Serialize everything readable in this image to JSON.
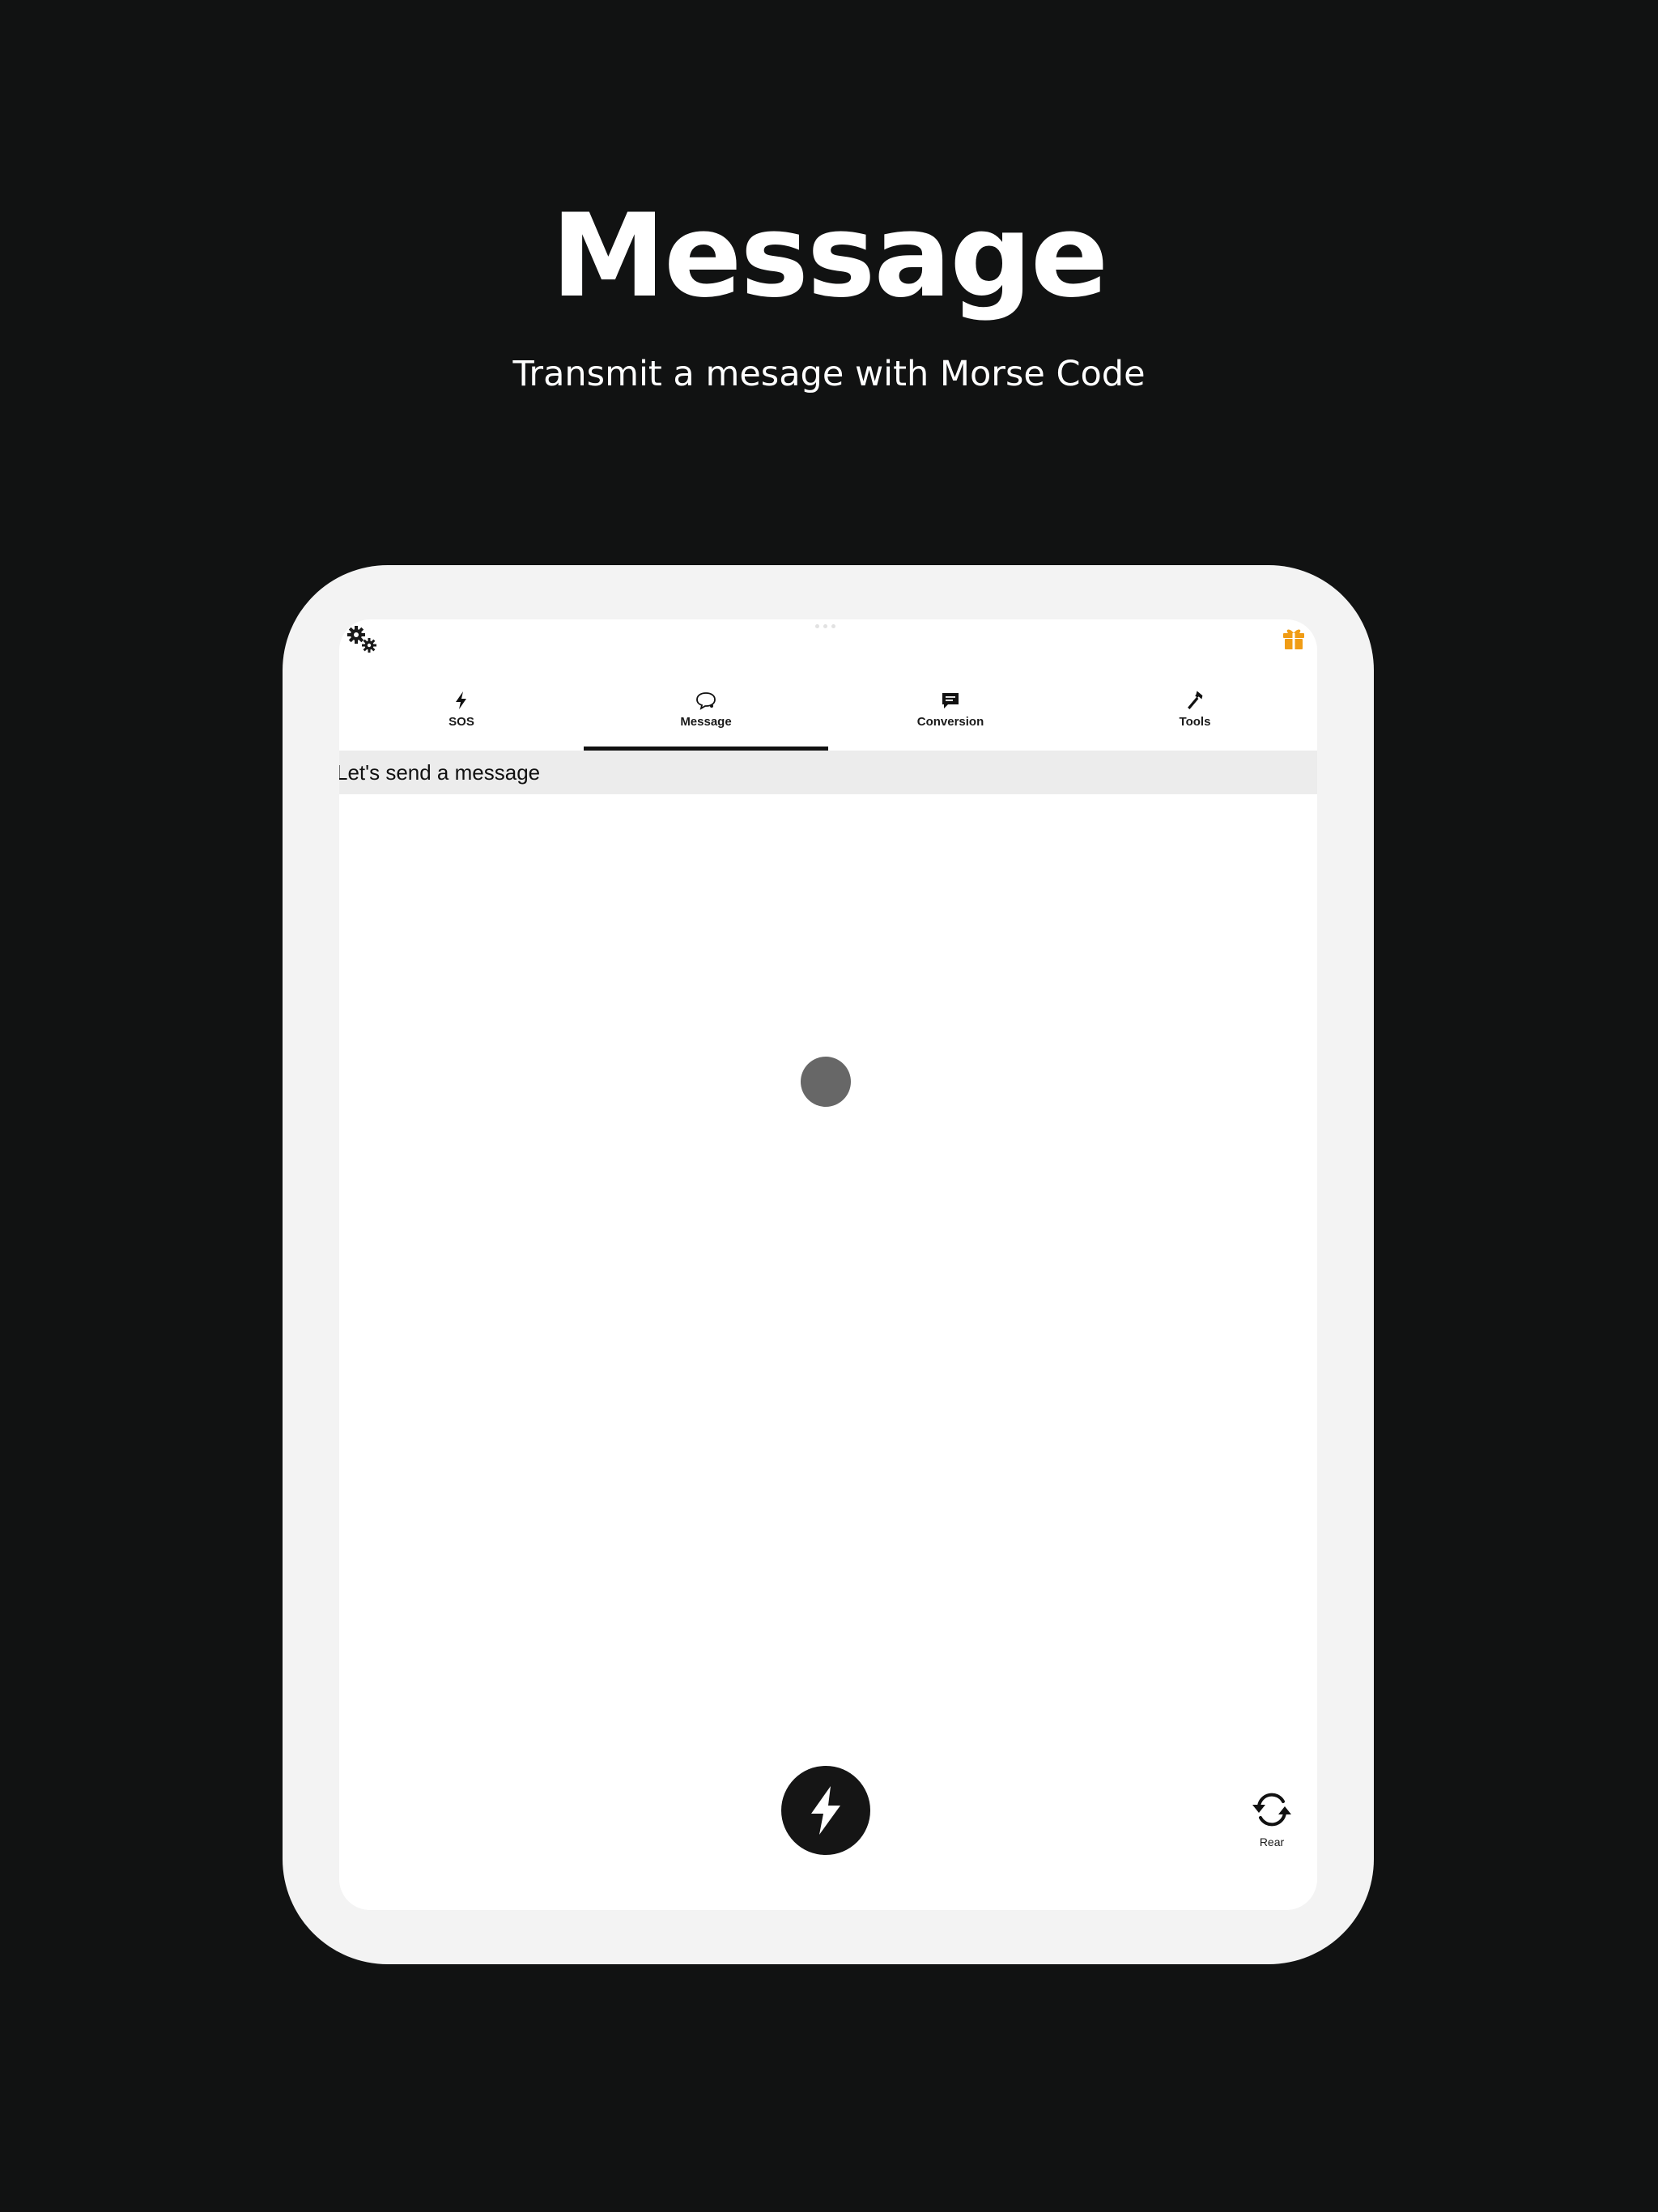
{
  "promo": {
    "title": "Message",
    "subtitle": "Transmit a mesage with Morse Code"
  },
  "toolbar": {
    "settings_icon": "gears-icon",
    "gift_icon": "gift-icon",
    "gift_color": "#f09c15"
  },
  "tabs": [
    {
      "label": "SOS",
      "icon": "bolt-icon",
      "active": false
    },
    {
      "label": "Message",
      "icon": "speech-bubble-icon",
      "active": true
    },
    {
      "label": "Conversion",
      "icon": "chat-bubble-icon",
      "active": false
    },
    {
      "label": "Tools",
      "icon": "hammer-icon",
      "active": false
    }
  ],
  "banner": {
    "text": "Let's send a message"
  },
  "controls": {
    "flash_icon": "bolt-icon",
    "camera_label": "Rear",
    "camera_icon": "rotate-camera-icon"
  },
  "colors": {
    "background": "#111212",
    "device_frame": "#f3f3f3",
    "indicator": "#676767",
    "flash_button": "#151515"
  }
}
